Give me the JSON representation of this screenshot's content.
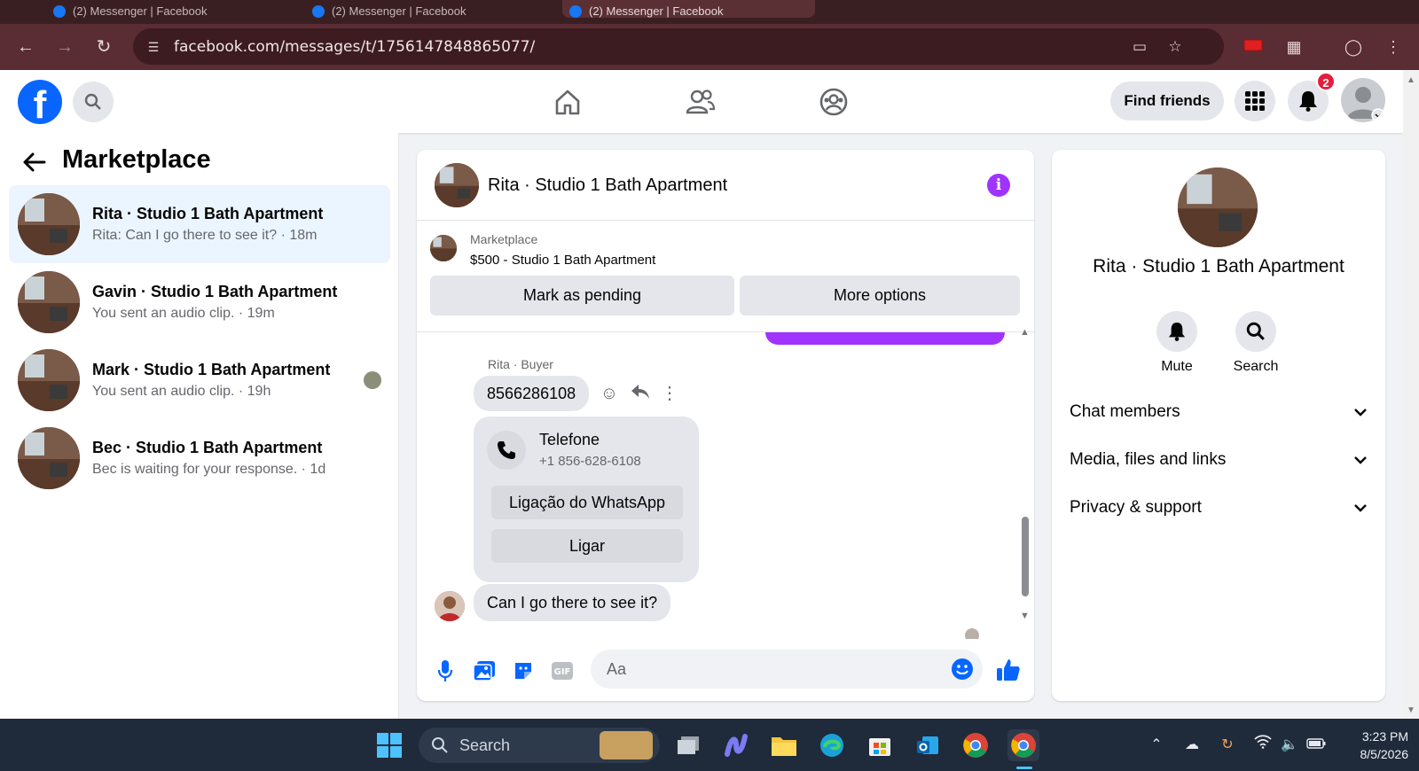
{
  "browser": {
    "tabs": [
      {
        "title": "(2) Messenger | Facebook"
      },
      {
        "title": "(2) Messenger | Facebook"
      },
      {
        "title": "(2) Messenger | Facebook"
      }
    ],
    "url": "facebook.com/messages/t/1756147848865077/"
  },
  "fb_header": {
    "find_friends_label": "Find friends",
    "notification_count": "2"
  },
  "sidebar": {
    "title": "Marketplace",
    "conversations": [
      {
        "name": "Rita · Studio 1 Bath Apartment",
        "preview": "Rita: Can I go there to see it? · 18m",
        "selected": true
      },
      {
        "name": "Gavin · Studio 1 Bath Apartment",
        "preview": "You sent an audio clip. · 19m",
        "selected": false
      },
      {
        "name": "Mark · Studio 1 Bath Apartment",
        "preview": "You sent an audio clip. · 19h",
        "selected": false
      },
      {
        "name": "Bec · Studio 1 Bath Apartment",
        "preview": "Bec is waiting for your response. · 1d",
        "selected": false
      }
    ]
  },
  "chat": {
    "title": "Rita · Studio 1 Bath Apartment",
    "marketplace_label": "Marketplace",
    "listing": "$500 - Studio 1 Bath Apartment",
    "mark_pending_label": "Mark as pending",
    "more_options_label": "More options",
    "sender_label": "Rita · Buyer",
    "phone_message": "8566286108",
    "contact_card": {
      "title": "Telefone",
      "number": "+1 856-628-6108",
      "whatsapp_label": "Ligação do WhatsApp",
      "call_label": "Ligar"
    },
    "last_message": "Can I go there to see it?",
    "composer_placeholder": "Aa"
  },
  "details_panel": {
    "name": "Rita · Studio 1 Bath Apartment",
    "mute_label": "Mute",
    "search_label": "Search",
    "sections": [
      {
        "label": "Chat members"
      },
      {
        "label": "Media, files and links"
      },
      {
        "label": "Privacy & support"
      }
    ]
  },
  "taskbar": {
    "search_label": "Search",
    "time": "3:23 PM",
    "date": "8/5/2026"
  },
  "colors": {
    "messenger_purple": "#a033ff",
    "fb_blue": "#0866ff",
    "selected_row": "#ebf5ff",
    "browser_frame": "#5a2c33"
  }
}
